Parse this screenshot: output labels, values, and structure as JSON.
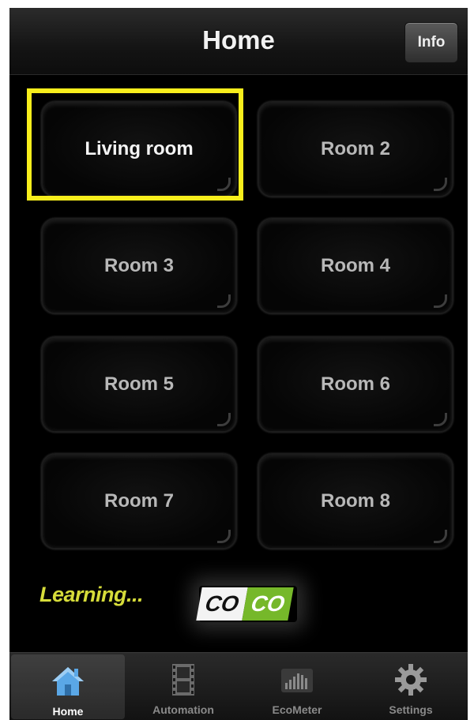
{
  "navbar": {
    "title": "Home",
    "info_label": "Info"
  },
  "rooms": [
    {
      "label": "Living room"
    },
    {
      "label": "Room 2"
    },
    {
      "label": "Room 3"
    },
    {
      "label": "Room 4"
    },
    {
      "label": "Room 5"
    },
    {
      "label": "Room 6"
    },
    {
      "label": "Room 7"
    },
    {
      "label": "Room 8"
    }
  ],
  "status": {
    "learning_text": "Learning..."
  },
  "logo": {
    "part1": "CO",
    "part2": "CO"
  },
  "tabs": [
    {
      "label": "Home",
      "icon": "home-icon",
      "selected": true
    },
    {
      "label": "Automation",
      "icon": "film-icon",
      "selected": false
    },
    {
      "label": "EcoMeter",
      "icon": "bar-meter-icon",
      "selected": false
    },
    {
      "label": "Settings",
      "icon": "gear-icon",
      "selected": false
    }
  ],
  "colors": {
    "highlight": "#f7ee1c",
    "learning_text": "#d6dc3a",
    "logo_green": "#76b82a",
    "home_icon": "#5aa7e6"
  }
}
